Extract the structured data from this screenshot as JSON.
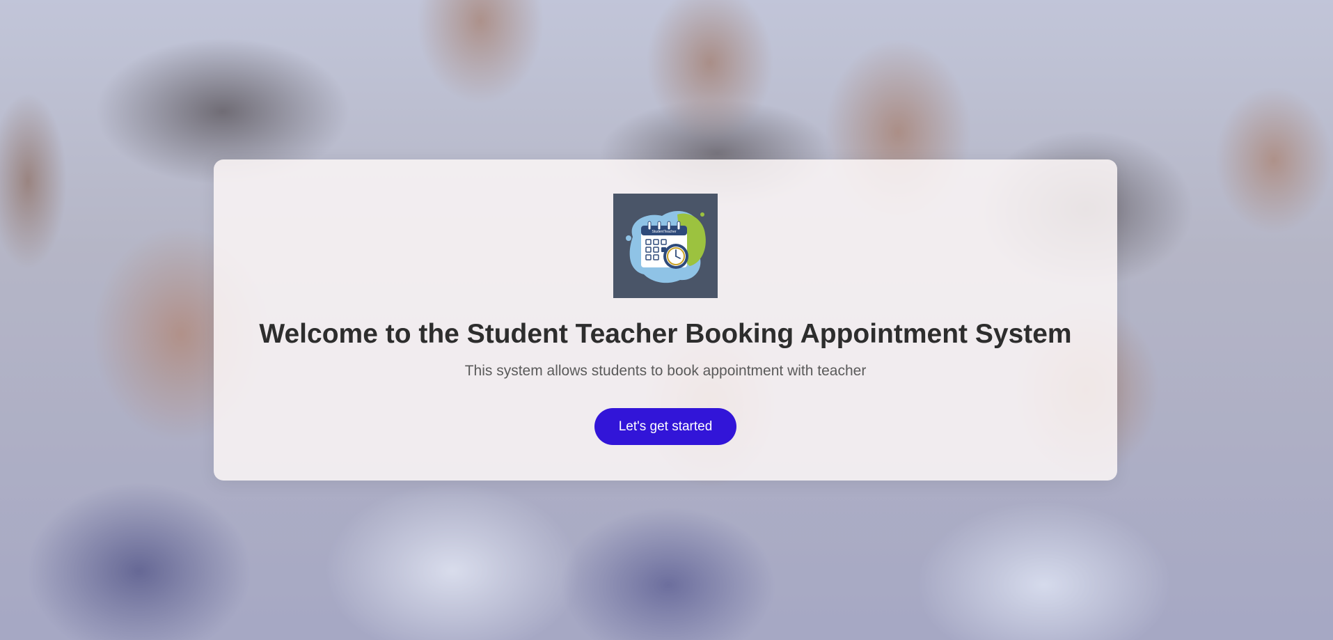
{
  "page": {
    "background": "photo of smiling schoolchildren in uniforms"
  },
  "card": {
    "logo": {
      "icon": "calendar-clock-icon",
      "text": "StudentTeacher",
      "colors": {
        "tile": "#4a5568",
        "blob_blue": "#8fc3e6",
        "blob_green": "#9cc23f",
        "calendar_header": "#2e4a7a"
      }
    },
    "title": "Welcome to the Student Teacher Booking Appointment System",
    "subtitle": "This system allows students to book appointment with teacher",
    "cta_label": "Let's get started"
  },
  "colors": {
    "accent": "#3215d8",
    "title_text": "#2d2d2d",
    "subtitle_text": "#5a5a5a",
    "card_bg": "#fcf6f6"
  }
}
